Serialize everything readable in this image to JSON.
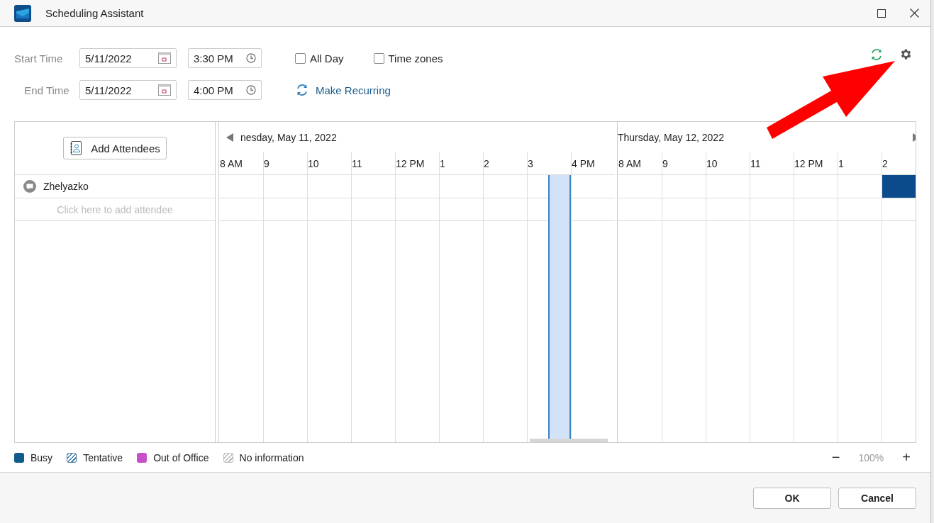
{
  "window": {
    "title": "Scheduling Assistant"
  },
  "times": [
    {
      "label": "Start Time",
      "date": "5/11/2022",
      "time": "3:30 PM"
    },
    {
      "label": "End Time",
      "date": "5/11/2022",
      "time": "4:00 PM"
    }
  ],
  "options": [
    {
      "label": "All Day",
      "checked": false
    },
    {
      "label": "Time zones",
      "checked": false
    }
  ],
  "make_recurring": "Make Recurring",
  "add_attendees": "Add Attendees",
  "attendees": [
    {
      "name": "Zhelyazko",
      "busy": [
        [
          false,
          false,
          false,
          false,
          false,
          false,
          false,
          false,
          false
        ],
        [
          false,
          false,
          false,
          false,
          false,
          false,
          true
        ]
      ]
    }
  ],
  "add_attendee_placeholder": "Click here to add attendee",
  "days": [
    {
      "title": "nesday, May 11, 2022",
      "hours": [
        {
          "label": "8 AM",
          "selected": false
        },
        {
          "label": "9",
          "selected": false
        },
        {
          "label": "10",
          "selected": false
        },
        {
          "label": "11",
          "selected": false
        },
        {
          "label": "12 PM",
          "selected": false
        },
        {
          "label": "1",
          "selected": false
        },
        {
          "label": "2",
          "selected": false
        },
        {
          "label": "3",
          "selected": true
        },
        {
          "label": "4 PM",
          "selected": false
        }
      ]
    },
    {
      "title": "Thursday, May 12, 2022",
      "hours": [
        {
          "label": "8 AM",
          "selected": false
        },
        {
          "label": "9",
          "selected": false
        },
        {
          "label": "10",
          "selected": false
        },
        {
          "label": "11",
          "selected": false
        },
        {
          "label": "12 PM",
          "selected": false
        },
        {
          "label": "1",
          "selected": false
        },
        {
          "label": "2",
          "selected": false
        }
      ]
    }
  ],
  "legend": [
    {
      "label": "Busy",
      "kind": "solid",
      "color": "#0f5c8c"
    },
    {
      "label": "Tentative",
      "kind": "hatched",
      "color": "#4a7fa8"
    },
    {
      "label": "Out of Office",
      "kind": "solid",
      "color": "#c74fc9"
    },
    {
      "label": "No information",
      "kind": "hatched",
      "color": "#bbbbbb"
    }
  ],
  "zoom": {
    "out": "−",
    "value": "100%",
    "in": "+"
  },
  "buttons": [
    "OK",
    "Cancel"
  ]
}
